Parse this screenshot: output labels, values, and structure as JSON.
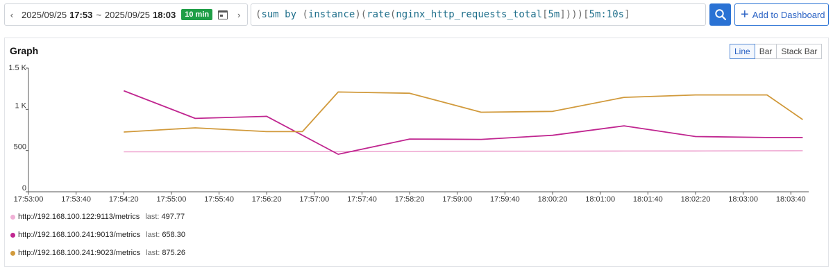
{
  "time_picker": {
    "prev_label": "‹",
    "next_label": "›",
    "start_date": "2025/09/25",
    "start_time": "17:53",
    "separator": "~",
    "end_date": "2025/09/25",
    "end_time": "18:03",
    "duration": "10 min",
    "calendar_icon": "calendar-icon"
  },
  "query": {
    "tokens": [
      {
        "text": "(",
        "kind": "paren"
      },
      {
        "text": "sum by ",
        "kind": "fn"
      },
      {
        "text": "(",
        "kind": "paren"
      },
      {
        "text": "instance",
        "kind": "text"
      },
      {
        "text": ")(",
        "kind": "paren"
      },
      {
        "text": "rate",
        "kind": "fn"
      },
      {
        "text": "(",
        "kind": "paren"
      },
      {
        "text": "nginx_http_requests_total",
        "kind": "text"
      },
      {
        "text": "[",
        "kind": "paren"
      },
      {
        "text": "5m",
        "kind": "text"
      },
      {
        "text": "])))",
        "kind": "paren"
      },
      {
        "text": "[",
        "kind": "paren"
      },
      {
        "text": "5m:10s",
        "kind": "text"
      },
      {
        "text": "]",
        "kind": "paren"
      }
    ]
  },
  "search_button_icon": "search-icon",
  "add_dashboard": {
    "icon": "plus-icon",
    "label": "Add to Dashboard"
  },
  "panel": {
    "title": "Graph",
    "chart_types": [
      {
        "label": "Line",
        "active": true
      },
      {
        "label": "Bar",
        "active": false
      },
      {
        "label": "Stack Bar",
        "active": false
      }
    ]
  },
  "colors": {
    "accent": "#2a72d4",
    "badge": "#1e9e46"
  },
  "chart_data": {
    "type": "line",
    "x_tick_labels": [
      "17:53:00",
      "17:53:40",
      "17:54:20",
      "17:55:00",
      "17:55:40",
      "17:56:20",
      "17:57:00",
      "17:57:40",
      "17:58:20",
      "17:59:00",
      "17:59:40",
      "18:00:20",
      "18:01:00",
      "18:01:40",
      "18:02:20",
      "18:03:00",
      "18:03:40"
    ],
    "y_tick_labels": [
      "0",
      "500",
      "1 K",
      "1.5 K"
    ],
    "y_ticks": [
      0,
      500,
      1000,
      1500
    ],
    "ylim": [
      0,
      1500
    ],
    "x_range_seconds": [
      0,
      655
    ],
    "series": [
      {
        "name": "http://192.168.100.122:9113/metrics",
        "color": "#f0b0d6",
        "last": "497.77",
        "x_seconds": [
          80,
          140,
          200,
          260,
          320,
          380,
          440,
          500,
          560,
          620,
          650
        ],
        "values": [
          485,
          486,
          488,
          489,
          490,
          491,
          492,
          494,
          495,
          497,
          497.77
        ]
      },
      {
        "name": "http://192.168.100.241:9013/metrics",
        "color": "#c02690",
        "last": "658.30",
        "x_seconds": [
          80,
          140,
          200,
          260,
          320,
          380,
          440,
          500,
          560,
          620,
          650
        ],
        "values": [
          1225,
          890,
          915,
          455,
          640,
          635,
          685,
          800,
          670,
          658.3,
          658.3
        ]
      },
      {
        "name": "http://192.168.100.241:9023/metrics",
        "color": "#d19a3c",
        "last": "875.26",
        "x_seconds": [
          80,
          140,
          200,
          230,
          260,
          320,
          380,
          440,
          500,
          560,
          620,
          650
        ],
        "values": [
          725,
          775,
          730,
          730,
          1210,
          1195,
          965,
          975,
          1145,
          1175,
          1175,
          875.26
        ]
      }
    ]
  }
}
